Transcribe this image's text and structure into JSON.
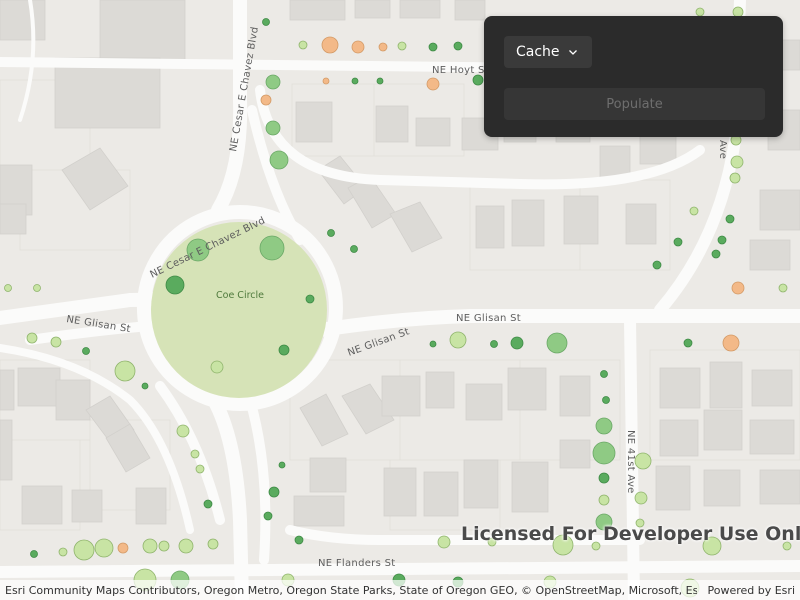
{
  "map": {
    "street_labels": {
      "hoyt": "NE Hoyt St",
      "chavez_n": "NE Cesar E Chavez Blvd",
      "chavez_w": "NE Cesar E Chavez Blvd",
      "glisan_w": "NE Glisan St",
      "glisan_c": "NE Glisan St",
      "glisan_e": "NE Glisan St",
      "ave_41": "NE 41st Ave",
      "ave_top": "Ave",
      "flanders": "NE Flanders St"
    },
    "park_label": "Coe Circle",
    "colors": {
      "background": "#eceae6",
      "road": "#fbfbfa",
      "building": "#dcdad6",
      "park": "#d6e3b7",
      "tree_dark_green": "#5aab5e",
      "tree_green": "#8fca84",
      "tree_light_green": "#c8e4a4",
      "tree_orange": "#f3b988"
    }
  },
  "controls": {
    "dropdown_value": "Cache",
    "chevron_icon": "chevron-down-icon",
    "populate_label": "Populate"
  },
  "watermark": "Licensed For Developer Use Only",
  "attribution": {
    "text": "Esri Community Maps Contributors, Oregon Metro, Oregon State Parks, State of Oregon GEO, © OpenStreetMap, Microsoft, Esri, H...",
    "powered_by": "Powered by Esri"
  }
}
